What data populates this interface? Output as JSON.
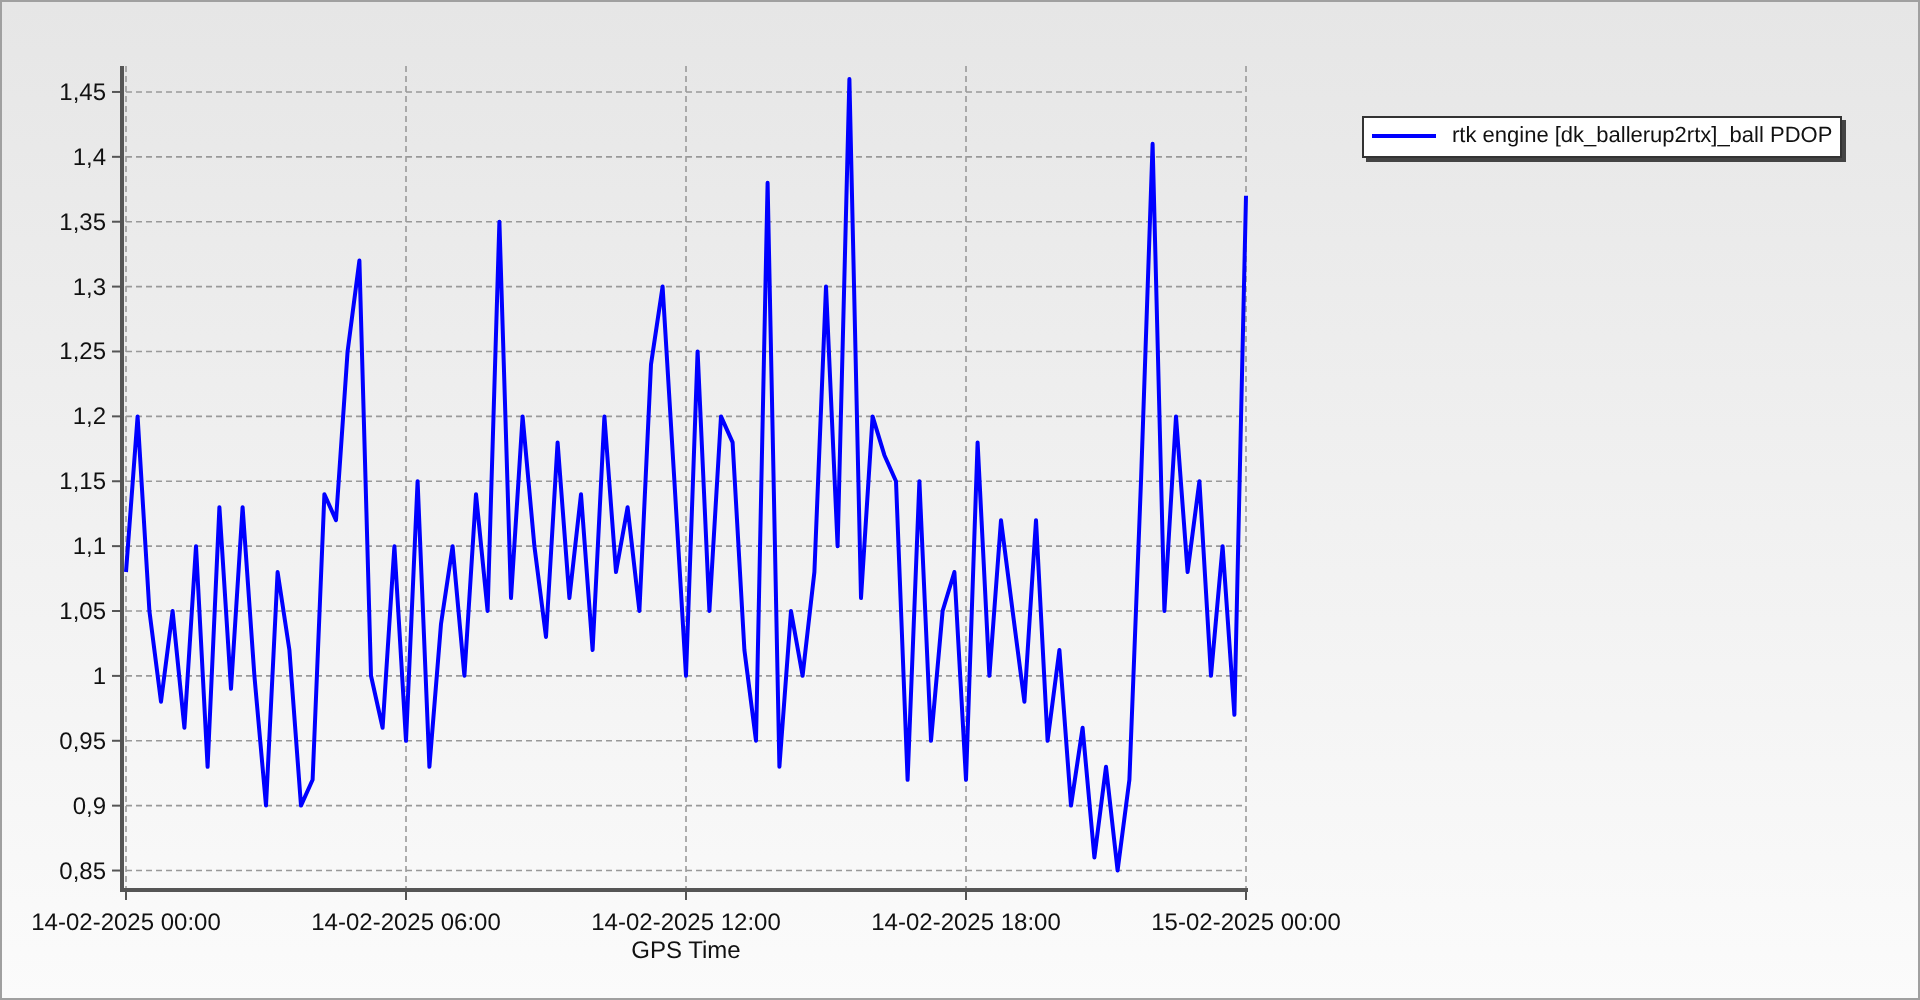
{
  "chart": {
    "chart_data": {
      "type": "line",
      "grid": true,
      "xlabel": "GPS Time",
      "categories": [
        "14-02-2025 00:00",
        null,
        null,
        null,
        null,
        null,
        null,
        null,
        null,
        null,
        null,
        null,
        null,
        null,
        null,
        null,
        null,
        null,
        null,
        null,
        null,
        null,
        null,
        null,
        "14-02-2025 06:00",
        null,
        null,
        null,
        null,
        null,
        null,
        null,
        null,
        null,
        null,
        null,
        null,
        null,
        null,
        null,
        null,
        null,
        null,
        null,
        null,
        null,
        null,
        null,
        "14-02-2025 12:00",
        null,
        null,
        null,
        null,
        null,
        null,
        null,
        null,
        null,
        null,
        null,
        null,
        null,
        null,
        null,
        null,
        null,
        null,
        null,
        null,
        null,
        null,
        null,
        "14-02-2025 18:00",
        null,
        null,
        null,
        null,
        null,
        null,
        null,
        null,
        null,
        null,
        null,
        null,
        null,
        null,
        null,
        null,
        null,
        null,
        null,
        null,
        null,
        null,
        null,
        "15-02-2025 00:00"
      ],
      "series": [
        {
          "name": "rtk engine [dk_ballerup2rtx]_ball PDOP",
          "color": "#0000ff",
          "values": [
            1.08,
            1.2,
            1.05,
            0.98,
            1.05,
            0.96,
            1.1,
            0.93,
            1.13,
            0.99,
            1.13,
            1.0,
            0.9,
            1.08,
            1.02,
            0.9,
            0.92,
            1.14,
            1.12,
            1.25,
            1.32,
            1.0,
            0.96,
            1.1,
            0.95,
            1.15,
            0.93,
            1.04,
            1.1,
            1.0,
            1.14,
            1.05,
            1.35,
            1.06,
            1.2,
            1.1,
            1.03,
            1.18,
            1.06,
            1.14,
            1.02,
            1.2,
            1.08,
            1.13,
            1.05,
            1.24,
            1.3,
            1.15,
            1.0,
            1.25,
            1.05,
            1.2,
            1.18,
            1.02,
            0.95,
            1.38,
            0.93,
            1.05,
            1.0,
            1.08,
            1.3,
            1.1,
            1.46,
            1.06,
            1.2,
            1.17,
            1.15,
            0.92,
            1.15,
            0.95,
            1.05,
            1.08,
            0.92,
            1.18,
            1.0,
            1.12,
            1.05,
            0.98,
            1.12,
            0.95,
            1.02,
            0.9,
            0.96,
            0.86,
            0.93,
            0.85,
            0.92,
            1.15,
            1.41,
            1.05,
            1.2,
            1.08,
            1.15,
            1.0,
            1.1,
            0.97,
            1.37
          ]
        }
      ],
      "ylim": [
        0.835,
        1.47
      ],
      "yticks": [
        {
          "value": 0.85,
          "label": "0,85"
        },
        {
          "value": 0.9,
          "label": "0,9"
        },
        {
          "value": 0.95,
          "label": "0,95"
        },
        {
          "value": 1,
          "label": "1"
        },
        {
          "value": 1.05,
          "label": "1,05"
        },
        {
          "value": 1.1,
          "label": "1,1"
        },
        {
          "value": 1.15,
          "label": "1,15"
        },
        {
          "value": 1.2,
          "label": "1,2"
        },
        {
          "value": 1.25,
          "label": "1,25"
        },
        {
          "value": 1.3,
          "label": "1,3"
        },
        {
          "value": 1.35,
          "label": "1,35"
        },
        {
          "value": 1.4,
          "label": "1,4"
        },
        {
          "value": 1.45,
          "label": "1,45"
        }
      ]
    }
  }
}
